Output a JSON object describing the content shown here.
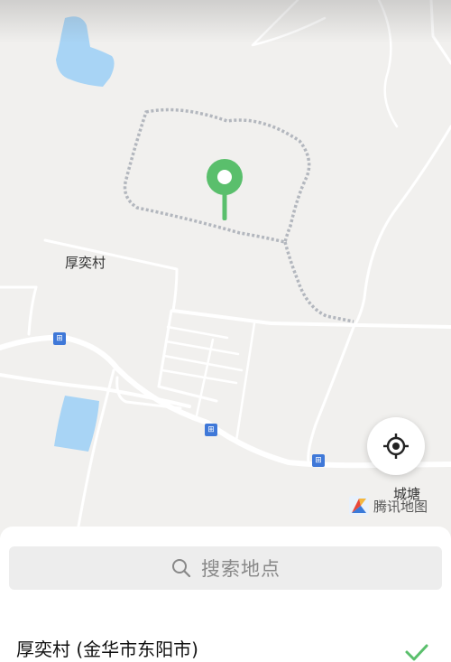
{
  "map": {
    "labels": {
      "village": "厚奕村",
      "town": "城塘"
    },
    "bus_stop_glyph": "⊞",
    "brand": "腾讯地图",
    "colors": {
      "land": "#f1f0ee",
      "water": "#a8d4f5",
      "road": "#ffffff",
      "boundary": "#b9bcc2",
      "pin": "#5abf6c",
      "bus": "#3f78d8"
    },
    "icons": [
      "marker-pin-icon",
      "locate-icon",
      "bus-stop-icon",
      "tencent-map-logo"
    ]
  },
  "sheet": {
    "search_placeholder": "搜索地点",
    "results": [
      {
        "name": "厚奕村 (金华市东阳市)",
        "selected": true
      }
    ]
  }
}
